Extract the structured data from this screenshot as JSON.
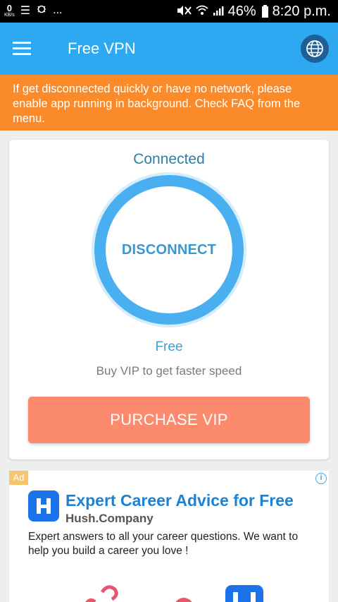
{
  "status_bar": {
    "speed_value": "0",
    "speed_unit": "KB/s",
    "battery": "46%",
    "time": "8:20 p.m.",
    "more": "...",
    "icons": [
      "list-icon",
      "bug-icon",
      "mute-icon",
      "wifi-icon",
      "signal-icon",
      "battery-icon"
    ]
  },
  "app_bar": {
    "title": "Free VPN",
    "color": "#2ea8f1",
    "icons": [
      "menu-icon",
      "globe-icon"
    ]
  },
  "notice": {
    "text": "If get disconnected quickly or have no network, please enable app running in background. Check FAQ from the menu.",
    "color": "#fb8b2a"
  },
  "main": {
    "status": "Connected",
    "action_label": "DISCONNECT",
    "plan": "Free",
    "hint": "Buy VIP to get faster speed",
    "purchase_label": "PURCHASE VIP",
    "ring_color": "#49aff1",
    "purchase_color": "#fb8b6c"
  },
  "ad": {
    "badge": "Ad",
    "info_icon": "i",
    "title": "Expert Career Advice for Free",
    "company": "Hush.Company",
    "body": "Expert answers to all your career questions. We want to help you build a career you love !",
    "logo_letter": "H"
  }
}
